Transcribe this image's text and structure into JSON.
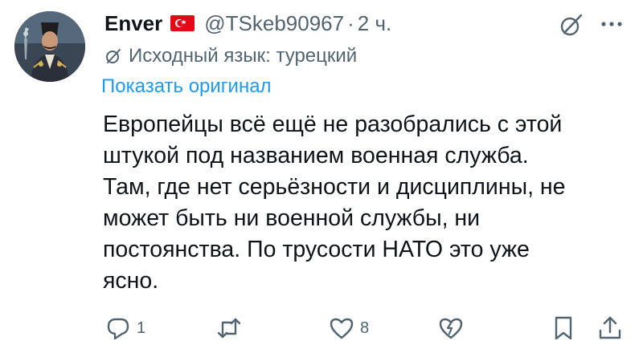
{
  "author": {
    "name": "Enver",
    "handle": "@TSkeb90967",
    "separator": "·",
    "time": "2 ч.",
    "flag_icon": "turkey-flag-icon"
  },
  "translation": {
    "label": "Исходный язык: турецкий",
    "show_original": "Показать оригинал"
  },
  "tweet_lines": [
    "Европейцы всё ещё не разобрались с этой",
    "штукой под названием военная служба.",
    "Там, где нет серьёзности и дисциплины, не",
    "может быть ни военной службы, ни",
    "постоянства. По трусости НАТО это уже",
    "ясно."
  ],
  "actions": {
    "reply_count": "1",
    "retweet_count": "",
    "like_count": "8"
  },
  "colors": {
    "text": "#0f1419",
    "secondary": "#536471",
    "link": "#1d9bf0",
    "flag_red": "#e30a17"
  }
}
